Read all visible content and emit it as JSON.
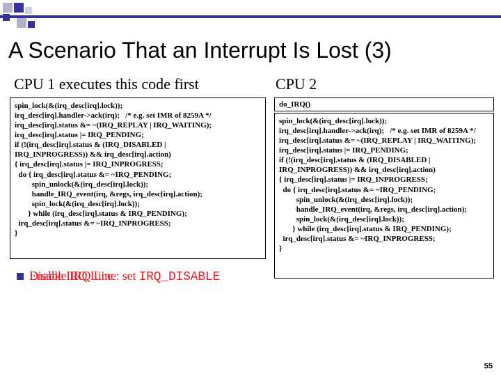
{
  "title": "A Scenario That an Interrupt Is Lost (3)",
  "headings": {
    "left": "CPU 1 executes this code first",
    "right": "CPU 2"
  },
  "code": {
    "cpu1": "spin_lock(&(irq_desc[irq].lock));\nirq_desc[irq].handler->ack(irq);   /* e.g. set IMR of 8259A */\nirq_desc[irq].status &= ~(IRQ_REPLAY | IRQ_WAITING);\nirq_desc[irq].status |= IRQ_PENDING;\nif (!(irq_desc[irq].status & (IRQ_DISABLED |\nIRQ_INPROGRESS)) && irq_desc[irq].action)\n{ irq_desc[irq].status |= IRQ_INPROGRESS;\n  do { irq_desc[irq].status &= ~IRQ_PENDING;\n         spin_unlock(&(irq_desc[irq].lock));\n         handle_IRQ_event(irq, &regs, irq_desc[irq].action);\n         spin_lock(&(irq_desc[irq].lock));\n       } while (irq_desc[irq].status & IRQ_PENDING);\n  irq_desc[irq].status &= ~IRQ_INPROGRESS;\n}",
    "cpu2_top": "do_IRQ()",
    "cpu2_main": "spin_lock(&(irq_desc[irq].lock));\nirq_desc[irq].handler->ack(irq);   /* e.g. set IMR of 8259A */\nirq_desc[irq].status &= ~(IRQ_REPLAY | IRQ_WAITING);\nirq_desc[irq].status |= IRQ_PENDING;\nif (!(irq_desc[irq].status & (IRQ_DISABLED |\nIRQ_INPROGRESS)) && irq_desc[irq].action)\n{ irq_desc[irq].status |= IRQ_INPROGRESS;\n  do { irq_desc[irq].status &= ~IRQ_PENDING;\n         spin_unlock(&(irq_desc[irq].lock));\n         handle_IRQ_event(irq, &regs, irq_desc[irq].action);\n         spin_lock(&(irq_desc[irq].lock));\n       } while (irq_desc[irq].status & IRQ_PENDING);\n  irq_desc[irq].status &= ~IRQ_INPROGRESS;\n}"
  },
  "bullets": {
    "overlay_prefix": "Disable IRQ Line: set ",
    "overlay_code": "IRQ_DISABLE",
    "enable_text": "Enable IRQ Line"
  },
  "page_number": "55"
}
